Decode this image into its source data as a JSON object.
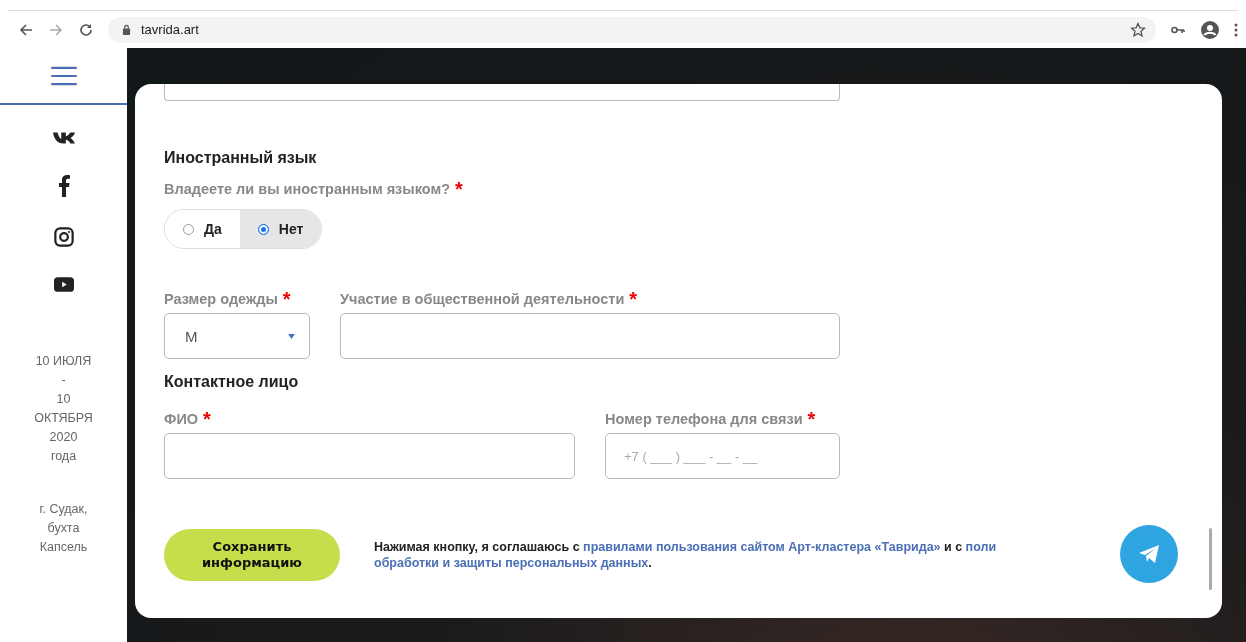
{
  "browser": {
    "url": "tavrida.art"
  },
  "sidebar": {
    "dates": [
      "10 ИЮЛЯ",
      "-",
      "10",
      "ОКТЯБРЯ",
      "2020",
      "года"
    ],
    "location": [
      "г. Судак,",
      "бухта",
      "Капсель"
    ],
    "social": [
      {
        "kind": "vk"
      },
      {
        "kind": "facebook"
      },
      {
        "kind": "instagram"
      },
      {
        "kind": "youtube"
      }
    ]
  },
  "form": {
    "required_mark": "*",
    "foreign_language": {
      "heading": "Иностранный язык",
      "question": "Владеете ли вы иностранным языком?",
      "required": true,
      "options": [
        {
          "label": "Да",
          "selected": false
        },
        {
          "label": "Нет",
          "selected": true
        }
      ]
    },
    "clothing_size": {
      "label": "Размер одежды",
      "required": true,
      "value": "M"
    },
    "social_activity": {
      "label": "Участие в общественной деятельности",
      "required": true
    },
    "contact": {
      "heading": "Контактное лицо",
      "name": {
        "label": "ФИО",
        "required": true
      },
      "phone": {
        "label": "Номер телефона для связи",
        "required": true,
        "placeholder": "+7 ( ___ ) ___ - __ - __"
      }
    },
    "save_button": "Сохранить информацию",
    "consent": [
      [
        {
          "kind": "text",
          "text": "Нажимая кнопку, я соглашаюсь с"
        },
        {
          "kind": "link",
          "text": "правилами пользования сайтом Арт-кластера «Таврида»"
        },
        {
          "kind": "text",
          "text": "и с"
        },
        {
          "kind": "link",
          "text": "поли"
        }
      ],
      [
        {
          "kind": "link",
          "text": "обработки и защиты персональных данных"
        },
        {
          "kind": "text",
          "text": "."
        }
      ]
    ]
  }
}
